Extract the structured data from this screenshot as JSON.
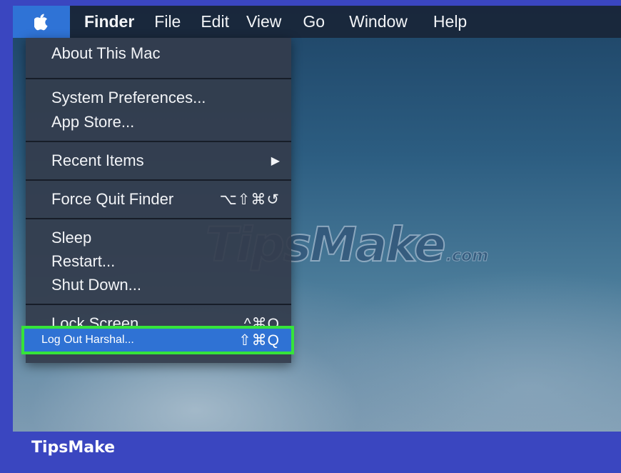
{
  "menubar": {
    "apple_icon": "apple-logo-icon",
    "items": [
      "Finder",
      "File",
      "Edit",
      "View",
      "Go",
      "Window",
      "Help"
    ]
  },
  "menu": {
    "about": "About This Mac",
    "system_prefs": "System Preferences...",
    "app_store": "App Store...",
    "recent_items": "Recent Items",
    "recent_arrow": "▶",
    "force_quit": "Force Quit Finder",
    "force_quit_shortcut": "⌥⇧⌘↺",
    "sleep": "Sleep",
    "restart": "Restart...",
    "shut_down": "Shut Down...",
    "lock_screen": "Lock Screen",
    "lock_screen_shortcut": "^⌘Q",
    "log_out": "Log Out Harshal...",
    "log_out_shortcut": "⇧⌘Q"
  },
  "watermark": {
    "main": "TipsMake",
    "suffix": ".com"
  },
  "footer": {
    "brand": "TipsMake"
  },
  "colors": {
    "menubar_bg": "#19263a",
    "apple_highlight": "#2f73d6",
    "menu_bg": "#343c4c",
    "selected_item": "#2f72d4",
    "highlight_border": "#36e43a",
    "outer_frame": "#3a46c0"
  }
}
